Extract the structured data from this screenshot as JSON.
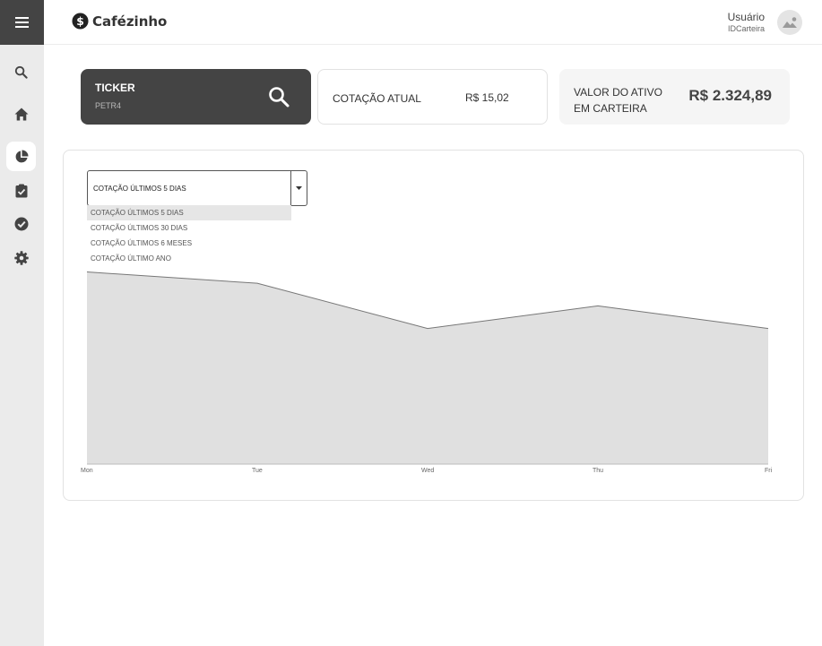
{
  "app": {
    "name": "Cafézinho"
  },
  "user": {
    "name": "Usuário",
    "id": "IDCarteira"
  },
  "sidebar": {
    "items": [
      {
        "name": "search",
        "icon": "search-icon"
      },
      {
        "name": "home",
        "icon": "home-icon"
      },
      {
        "name": "portfolio",
        "icon": "pie-chart-icon",
        "active": true
      },
      {
        "name": "tasks",
        "icon": "clipboard-check-icon"
      },
      {
        "name": "done",
        "icon": "check-circle-icon"
      },
      {
        "name": "settings",
        "icon": "gear-icon"
      }
    ]
  },
  "ticker": {
    "label": "TICKER",
    "value": "PETR4"
  },
  "cotacao": {
    "label": "COTAÇÃO ATUAL",
    "value": "R$ 15,02"
  },
  "valor": {
    "label": "VALOR DO ATIVO EM CARTEIRA",
    "value": "R$ 2.324,89"
  },
  "period_select": {
    "selected": "COTAÇÃO ÚLTIMOS 5 DIAS",
    "options": [
      "COTAÇÃO ÚLTIMOS 5 DIAS",
      "COTAÇÃO ÚLTIMOS 30 DIAS",
      "COTAÇÃO ÚLTIMOS 6 MESES",
      "COTAÇÃO ÚLTIMO ANO"
    ]
  },
  "colors": {
    "dark": "#444444",
    "sidebar": "#ebebeb",
    "area_fill": "#e0e0e0",
    "area_line": "#777777"
  },
  "chart_data": {
    "type": "area",
    "categories": [
      "Mon",
      "Tue",
      "Wed",
      "Thu",
      "Fri"
    ],
    "series": [
      {
        "values": [
          85,
          80,
          60,
          70,
          60
        ]
      }
    ],
    "ylim": [
      0,
      130
    ],
    "grid": false,
    "title": "",
    "xlabel": "",
    "ylabel": ""
  }
}
